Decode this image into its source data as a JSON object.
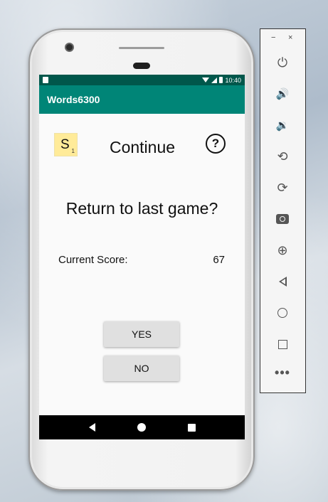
{
  "status_bar": {
    "time": "10:40"
  },
  "app_bar": {
    "title": "Words6300"
  },
  "tile": {
    "letter": "S",
    "points": "1"
  },
  "page": {
    "title": "Continue",
    "help_icon": "?",
    "question": "Return to last game?"
  },
  "score": {
    "label": "Current Score:",
    "value": "67"
  },
  "buttons": {
    "yes": "YES",
    "no": "NO"
  },
  "emulator": {
    "minimize": "−",
    "close": "×",
    "icons": [
      "power-icon",
      "volume-up-icon",
      "volume-down-icon",
      "rotate-left-icon",
      "rotate-right-icon",
      "camera-icon",
      "zoom-icon",
      "back-icon",
      "home-icon",
      "overview-icon",
      "more-icon"
    ],
    "glyphs": {
      "power": "⏻",
      "volume_up": "🔊",
      "volume_down": "🔉",
      "rotate": "⟲",
      "rotate_right": "⟳",
      "zoom": "⊕",
      "more": "•••"
    }
  },
  "colors": {
    "status_bar": "#00574b",
    "app_bar": "#008577",
    "tile": "#ffeb99",
    "button": "#e0e0e0",
    "screen_bg": "#fafafa"
  }
}
